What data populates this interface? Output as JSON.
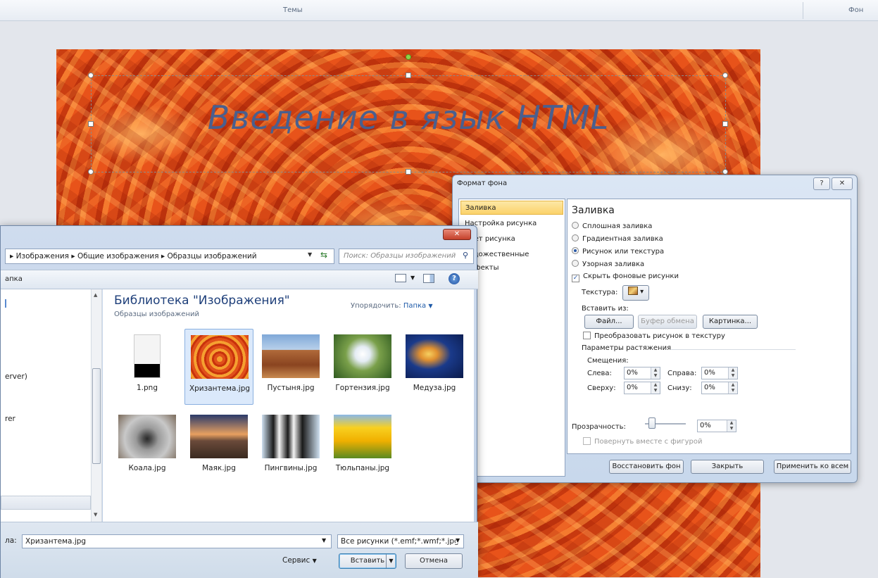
{
  "ribbon": {
    "group_themes": "Темы",
    "group_background": "Фон"
  },
  "slide": {
    "title": "Введение в язык HTML"
  },
  "format_dialog": {
    "title": "Формат фона",
    "help_label": "?",
    "close_label": "✕",
    "nav": [
      "Заливка",
      "Настройка рисунка",
      "Цвет рисунка",
      "Художественные эффекты"
    ],
    "section_title": "Заливка",
    "options": [
      "Сплошная заливка",
      "Градиентная заливка",
      "Рисунок или текстура",
      "Узорная заливка"
    ],
    "selected_option": "Рисунок или текстура",
    "hide_bg_label": "Скрыть фоновые рисунки",
    "texture_label": "Текстура:",
    "insert_from_label": "Вставить из:",
    "file_button": "Файл...",
    "clipboard_button": "Буфер обмена",
    "clipart_button": "Картинка...",
    "tile_label": "Преобразовать рисунок в текстуру",
    "stretch_label": "Параметры растяжения",
    "offsets_label": "Смещения:",
    "left_label": "Слева:",
    "left_value": "0%",
    "right_label": "Справа:",
    "right_value": "0%",
    "top_label": "Сверху:",
    "top_value": "0%",
    "bottom_label": "Снизу:",
    "bottom_value": "0%",
    "transparency_label": "Прозрачность:",
    "transparency_value": "0%",
    "rotate_label": "Повернуть вместе с фигурой",
    "reset_button": "Восстановить фон",
    "close_button": "Закрыть",
    "apply_all_button": "Применить ко всем"
  },
  "file_dialog": {
    "close_label": "✕",
    "breadcrumb": [
      "Изображения",
      "Общие изображения",
      "Образцы изображений"
    ],
    "search_placeholder": "Поиск: Образцы изображений",
    "toolbar_left": "апка",
    "nav_items": [
      "erver)",
      "rer"
    ],
    "library_title": "Библиотека \"Изображения\"",
    "library_subtitle": "Образцы изображений",
    "sort_label": "Упорядочить:",
    "sort_value": "Папка",
    "files": [
      "1.png",
      "Хризантема.jpg",
      "Пустыня.jpg",
      "Гортензия.jpg",
      "Медуза.jpg",
      "Коала.jpg",
      "Маяк.jpg",
      "Пингвины.jpg",
      "Тюльпаны.jpg"
    ],
    "selected_file": "Хризантема.jpg",
    "filename_label": "ла:",
    "filename_value": "Хризантема.jpg",
    "filetype_value": "Все рисунки (*.emf;*.wmf;*.jpg",
    "service_label": "Сервис",
    "insert_button": "Вставить",
    "cancel_button": "Отмена"
  }
}
